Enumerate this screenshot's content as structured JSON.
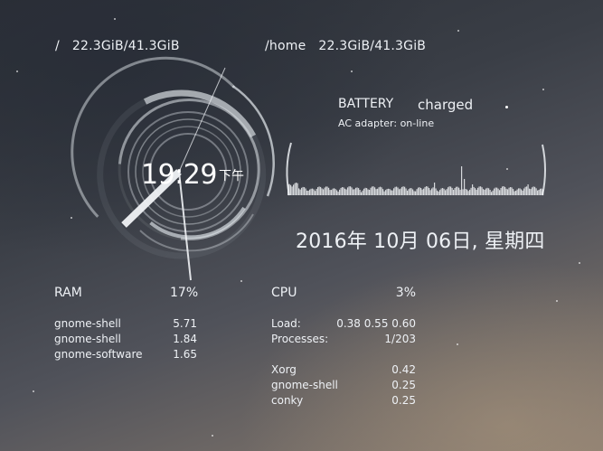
{
  "disks": [
    {
      "mount": "/",
      "usage": "22.3GiB/41.3GiB"
    },
    {
      "mount": "/home",
      "usage": "22.3GiB/41.3GiB"
    }
  ],
  "clock": {
    "time": "19:29",
    "ampm": "下午"
  },
  "battery": {
    "title": "BATTERY",
    "status": "charged",
    "ac_adapter": "AC adapter: on-line"
  },
  "date": "2016年 10月 06日, 星期四",
  "ram": {
    "label": "RAM",
    "percent": "17%",
    "processes": [
      {
        "name": "gnome-shell",
        "value": "5.71"
      },
      {
        "name": "gnome-shell",
        "value": "1.84"
      },
      {
        "name": "gnome-software",
        "value": "1.65"
      }
    ]
  },
  "cpu": {
    "label": "CPU",
    "percent": "3%",
    "load_label": "Load:",
    "load_value": "0.38 0.55 0.60",
    "processes_label": "Processes:",
    "processes_value": "1/203",
    "processes": [
      {
        "name": "Xorg",
        "value": "0.42"
      },
      {
        "name": "gnome-shell",
        "value": "0.25"
      },
      {
        "name": "conky",
        "value": "0.25"
      }
    ]
  }
}
